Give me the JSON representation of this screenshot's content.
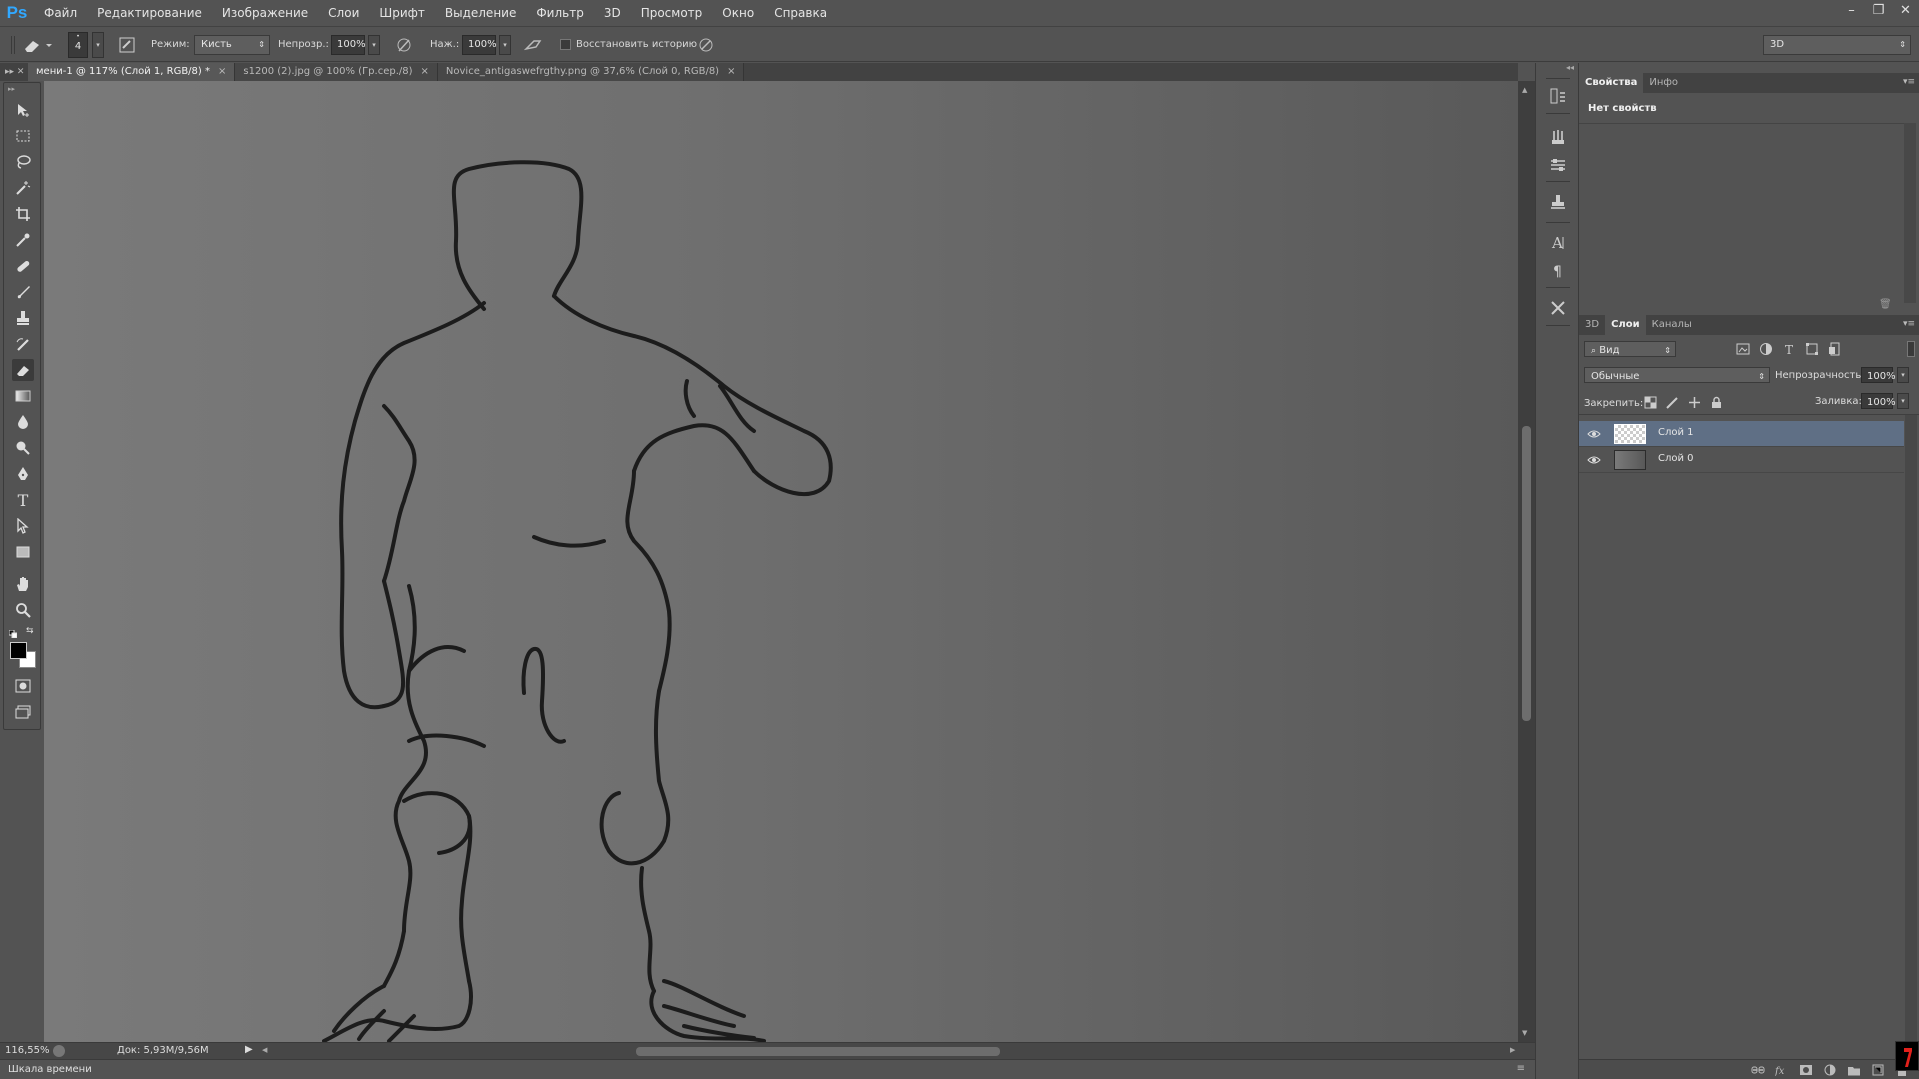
{
  "app": {
    "logo": "Ps"
  },
  "menu": [
    "Файл",
    "Редактирование",
    "Изображение",
    "Слои",
    "Шрифт",
    "Выделение",
    "Фильтр",
    "3D",
    "Просмотр",
    "Окно",
    "Справка"
  ],
  "window_controls": [
    "–",
    "❐",
    "✕"
  ],
  "options": {
    "brush_size": "4",
    "mode_label": "Режим:",
    "mode_value": "Кисть",
    "opacity_label": "Непрозр.:",
    "opacity_value": "100%",
    "pressure_label": "Наж.:",
    "pressure_value": "100%",
    "restore_history_label": "Восстановить историю",
    "workspace_value": "3D"
  },
  "tabs": [
    {
      "label": "мени-1 @ 117% (Слой 1, RGB/8) *",
      "active": true
    },
    {
      "label": "s1200 (2).jpg @ 100% (Гр.сер./8)",
      "active": false
    },
    {
      "label": "Novice_antigaswefrgthy.png @ 37,6% (Слой 0, RGB/8)",
      "active": false
    }
  ],
  "tab_close": "×",
  "status": {
    "zoom": "116,55%",
    "doc_info": "Док: 5,93M/9,56M",
    "timeline_label": "Шкала времени"
  },
  "properties_panel": {
    "tabs": [
      "Свойства",
      "Инфо"
    ],
    "empty_text": "Нет свойств"
  },
  "layers_panel": {
    "tabs": [
      "3D",
      "Слои",
      "Каналы"
    ],
    "filter_kind": "Вид",
    "blend_mode": "Обычные",
    "opacity_label": "Непрозрачность:",
    "opacity_value": "100%",
    "lock_label": "Закрепить:",
    "fill_label": "Заливка:",
    "fill_value": "100%",
    "layers": [
      {
        "name": "Слой 1",
        "selected": true
      },
      {
        "name": "Слой 0",
        "selected": false
      }
    ]
  },
  "colors": {
    "accent_selected_layer": "#5f6f85",
    "ps_logo": "#31a8ff",
    "canvas_left": "#7a7a7a",
    "canvas_right": "#595959",
    "stroke": "#111111"
  }
}
